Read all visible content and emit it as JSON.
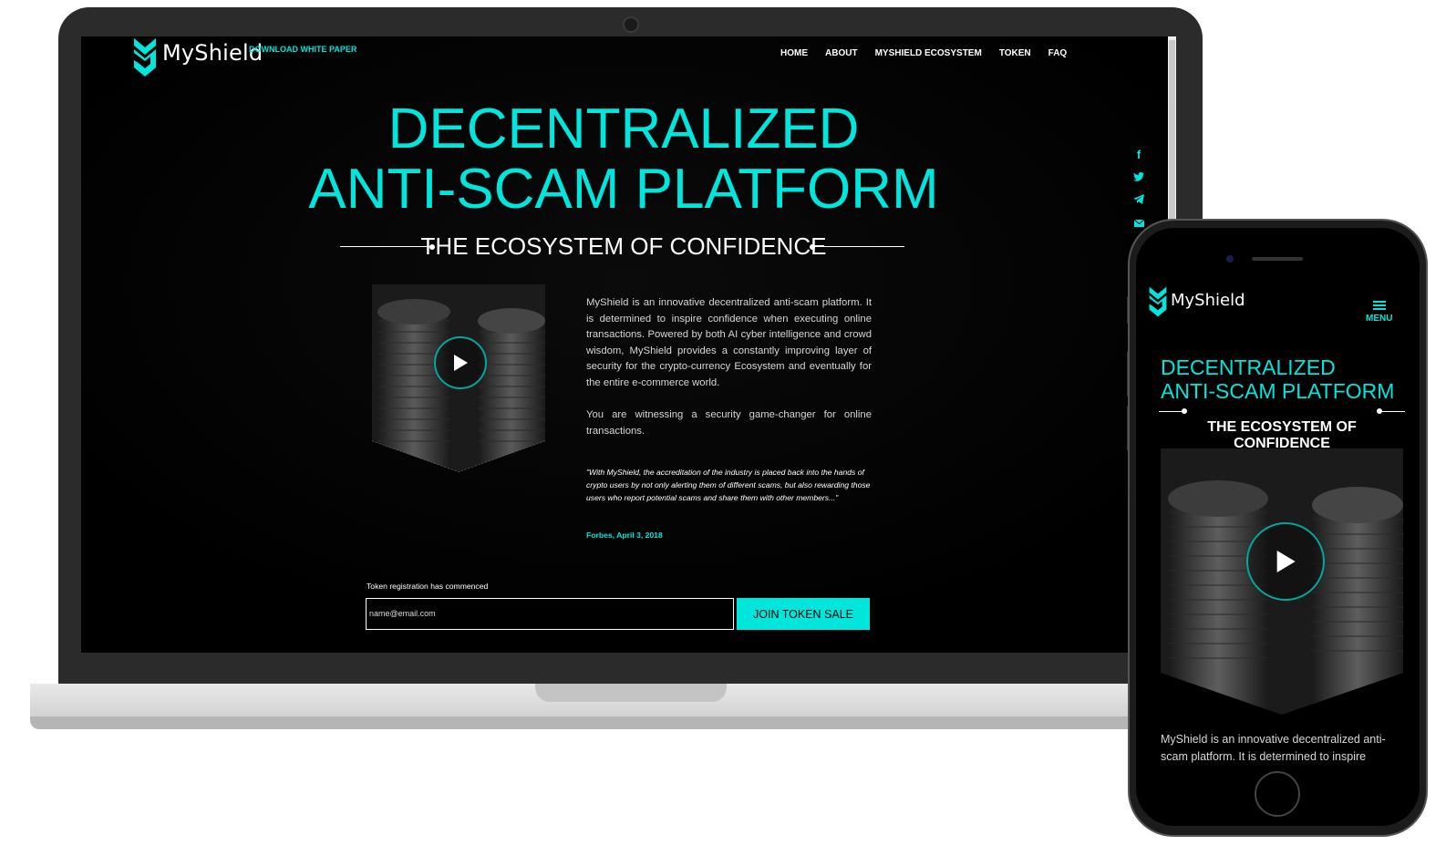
{
  "colors": {
    "accent": "#00e6dc",
    "background": "#000000",
    "device_frame": "#2b2b2b"
  },
  "desktop": {
    "logo": {
      "text": "MyShield",
      "icon": "shield-logo-icon"
    },
    "whitepaper_link": "DOWNLOAD WHITE PAPER",
    "nav": [
      {
        "label": "HOME"
      },
      {
        "label": "ABOUT"
      },
      {
        "label": "MYSHIELD ECOSYSTEM"
      },
      {
        "label": "TOKEN"
      },
      {
        "label": "FAQ"
      }
    ],
    "social": [
      "facebook-icon",
      "twitter-icon",
      "telegram-icon",
      "mail-icon"
    ],
    "hero": {
      "title_line1": "DECENTRALIZED",
      "title_line2": "ANTI-SCAM PLATFORM",
      "tagline": "THE ECOSYSTEM OF CONFIDENCE"
    },
    "description": "MyShield is an innovative decentralized anti-scam platform. It is determined to inspire confidence when executing online transactions. Powered by both AI cyber intelligence and crowd wisdom, MyShield provides a constantly improving layer of security for the crypto-currency Ecosystem and eventually for the entire e-commerce world.",
    "description2": "You are witnessing a security game-changer for online transactions.",
    "quote": "\"With MyShield, the accreditation of the industry is placed back into the hands of crypto users by not only alerting them of different scams, but also rewarding those users who report potential scams and share them with other members...\"",
    "citation": "Forbes, April 3, 2018",
    "registration": {
      "label": "Token registration has commenced",
      "email_value": "name@email.com",
      "button": "JOIN TOKEN SALE"
    }
  },
  "mobile": {
    "logo": {
      "text": "MyShield"
    },
    "menu_label": "MENU",
    "title_line1": "DECENTRALIZED",
    "title_line2": "ANTI-SCAM PLATFORM",
    "tagline": "THE ECOSYSTEM OF CONFIDENCE",
    "description": "MyShield is an innovative decentralized anti-scam platform. It is determined to inspire"
  }
}
